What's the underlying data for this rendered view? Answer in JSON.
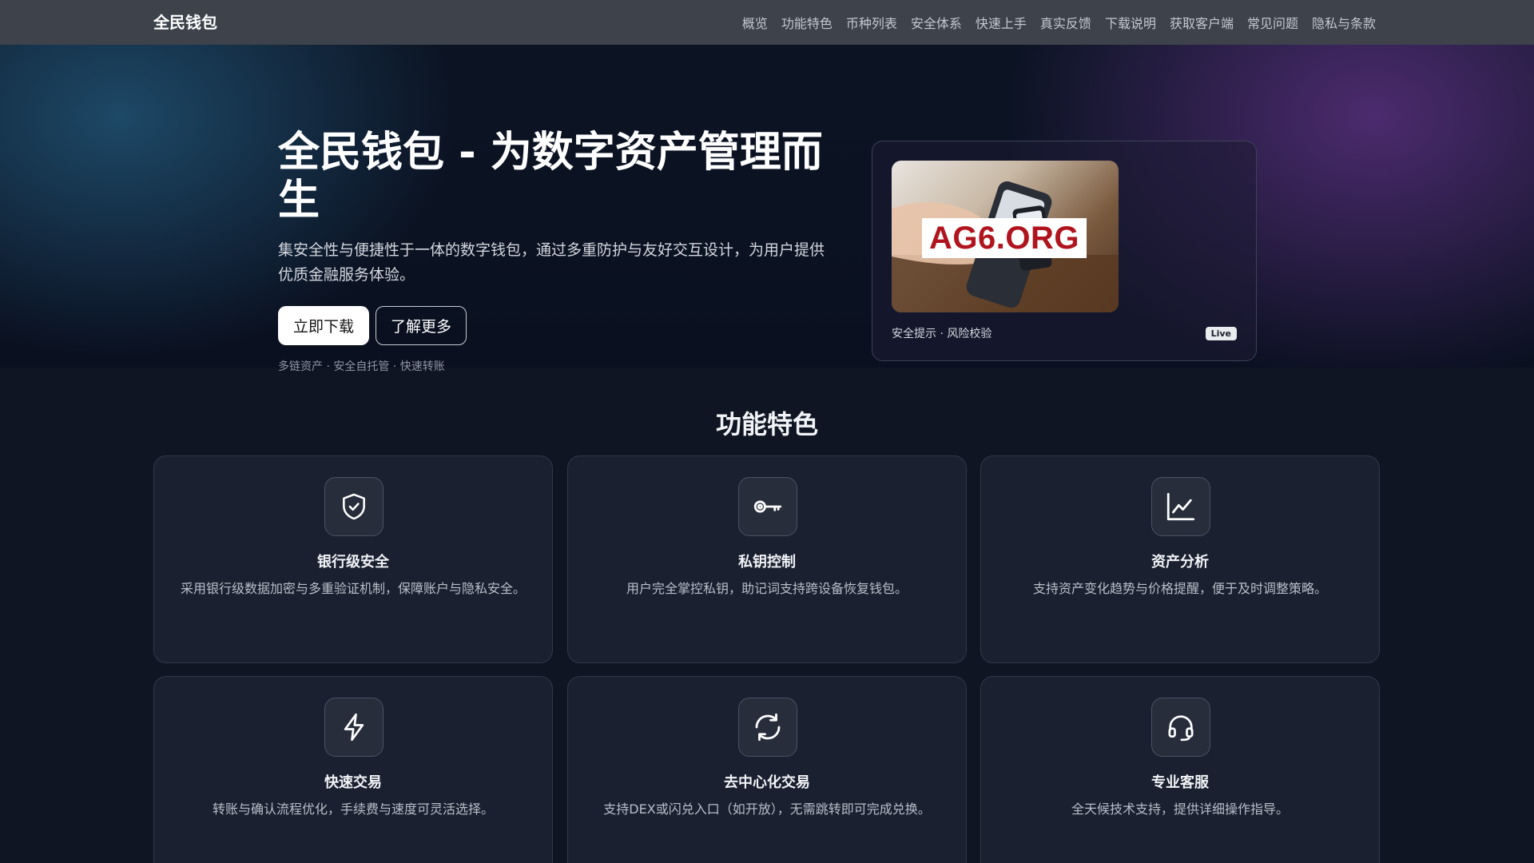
{
  "nav": {
    "brand": "全民钱包",
    "links": [
      "概览",
      "功能特色",
      "币种列表",
      "安全体系",
      "快速上手",
      "真实反馈",
      "下载说明",
      "获取客户端",
      "常见问题",
      "隐私与条款"
    ]
  },
  "hero": {
    "title": "全民钱包 - 为数字资产管理而生",
    "subtitle": "集安全性与便捷性于一体的数字钱包，通过多重防护与友好交互设计，为用户提供优质金融服务体验。",
    "primary_button": "立即下载",
    "secondary_button": "了解更多",
    "tags": "多链资产 · 安全自托管 · 快速转账",
    "card": {
      "image_logo_text": "AG6.ORG",
      "caption": "安全提示 · 风险校验",
      "badge": "Live"
    }
  },
  "features": {
    "title": "功能特色",
    "items": [
      {
        "icon": "shield-check-icon",
        "title": "银行级安全",
        "desc": "采用银行级数据加密与多重验证机制，保障账户与隐私安全。"
      },
      {
        "icon": "key-icon",
        "title": "私钥控制",
        "desc": "用户完全掌控私钥，助记词支持跨设备恢复钱包。"
      },
      {
        "icon": "chart-line-icon",
        "title": "资产分析",
        "desc": "支持资产变化趋势与价格提醒，便于及时调整策略。"
      },
      {
        "icon": "lightning-icon",
        "title": "快速交易",
        "desc": "转账与确认流程优化，手续费与速度可灵活选择。"
      },
      {
        "icon": "refresh-icon",
        "title": "去中心化交易",
        "desc": "支持DEX或闪兑入口（如开放），无需跳转即可完成兑换。"
      },
      {
        "icon": "headset-icon",
        "title": "专业客服",
        "desc": "全天候技术支持，提供详细操作指导。"
      }
    ]
  }
}
